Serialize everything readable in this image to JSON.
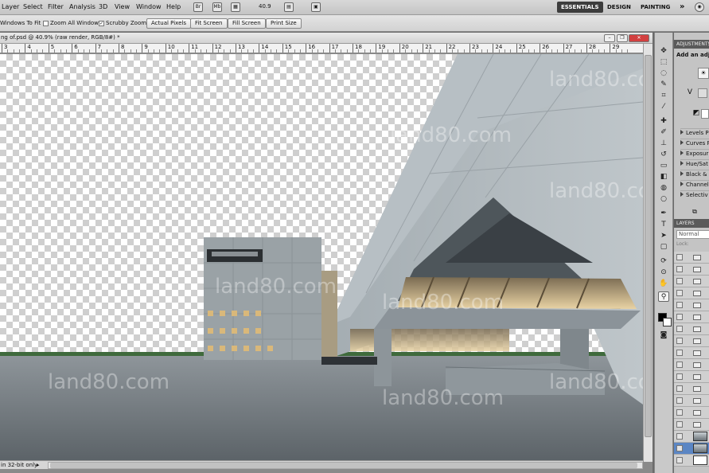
{
  "menubar": {
    "items": [
      "Layer",
      "Select",
      "Filter",
      "Analysis",
      "3D",
      "View",
      "Window",
      "Help"
    ],
    "zoom": "40.9",
    "workspaces": [
      "ESSENTIALS",
      "DESIGN",
      "PAINTING"
    ],
    "more": "»"
  },
  "options": {
    "resize_windows": "Windows To Fit",
    "zoom_all": "Zoom All Windows",
    "scrubby": "Scrubby Zoom",
    "buttons": [
      "Actual Pixels",
      "Fit Screen",
      "Fill Screen",
      "Print Size"
    ]
  },
  "document": {
    "title": "ng of.psd @ 40.9% (raw render, RGB/8#) *",
    "ruler_labels": [
      "3",
      "4",
      "5",
      "6",
      "7",
      "8",
      "9",
      "10",
      "11",
      "12",
      "13",
      "14",
      "15",
      "16",
      "17",
      "18",
      "19",
      "20",
      "21",
      "22",
      "23",
      "24",
      "25",
      "26",
      "27",
      "28",
      "29"
    ],
    "status": "in 32-bit only",
    "watermark": "land80.com"
  },
  "panels": {
    "adjustments_tab": "ADJUSTMENTS",
    "add_adjustment": "Add an adju",
    "adjustments": [
      "Levels P",
      "Curves P",
      "Exposur",
      "Hue/Sat",
      "Black &",
      "Channel",
      "Selectiv"
    ],
    "layers_tab": "LAYERS",
    "blend_mode": "Normal",
    "lock_label": "Lock:"
  },
  "colors": {
    "fg": "#000000",
    "bg": "#ffffff",
    "selection": "#5b86c4"
  }
}
